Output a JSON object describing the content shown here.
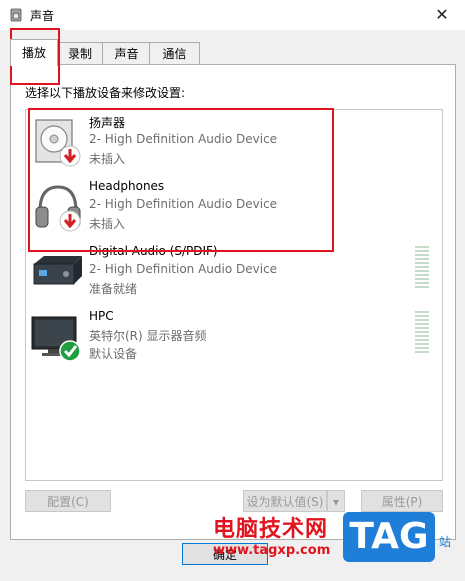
{
  "window": {
    "title": "声音",
    "icon": "speaker-icon",
    "close_glyph": "✕"
  },
  "tabs": [
    {
      "label": "播放",
      "selected": true
    },
    {
      "label": "录制",
      "selected": false
    },
    {
      "label": "声音",
      "selected": false
    },
    {
      "label": "通信",
      "selected": false
    }
  ],
  "instruction": "选择以下播放设备来修改设置:",
  "devices": [
    {
      "name": "扬声器",
      "subtitle": "2- High Definition Audio Device",
      "status": "未插入",
      "icon": "speaker-icon",
      "badge": "unplugged-arrow-icon"
    },
    {
      "name": "Headphones",
      "subtitle": "2- High Definition Audio Device",
      "status": "未插入",
      "icon": "headphones-icon",
      "badge": "unplugged-arrow-icon"
    },
    {
      "name": "Digital Audio (S/PDIF)",
      "subtitle": "2- High Definition Audio Device",
      "status": "准备就绪",
      "icon": "receiver-icon",
      "badge": ""
    },
    {
      "name": "HPC",
      "subtitle": "英特尔(R) 显示器音频",
      "status": "默认设备",
      "icon": "monitor-icon",
      "badge": "default-check-icon"
    }
  ],
  "buttons": {
    "configure": "配置(C)",
    "set_default": "设为默认值(S)",
    "properties": "属性(P)",
    "ok": "确定"
  },
  "watermark": {
    "text": "电脑技术网",
    "url": "www.tagxp.com",
    "logo": "TAG",
    "site": "站"
  },
  "colors": {
    "highlight": "#e0141e",
    "accent": "#0078d7",
    "badge_red": "#d32020",
    "badge_green": "#1e9e3e"
  }
}
